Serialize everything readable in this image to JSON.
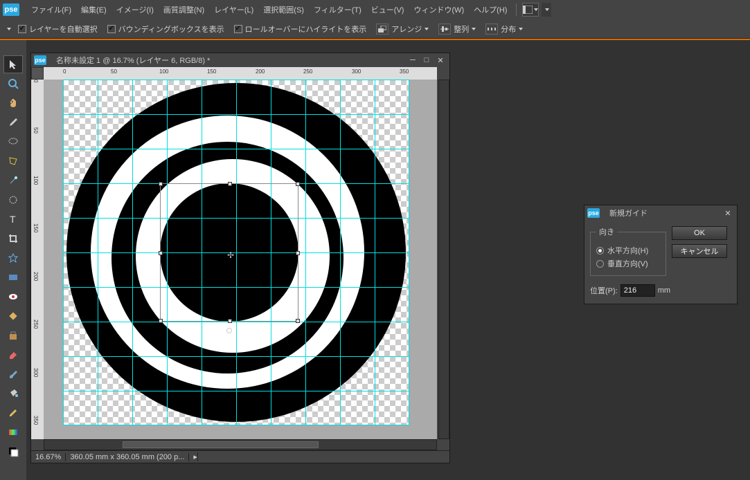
{
  "menubar": {
    "logo": "pse",
    "items": [
      "ファイル(F)",
      "編集(E)",
      "イメージ(I)",
      "画質調整(N)",
      "レイヤー(L)",
      "選択範囲(S)",
      "フィルター(T)",
      "ビュー(V)",
      "ウィンドウ(W)",
      "ヘルプ(H)"
    ]
  },
  "options": {
    "auto_select": "レイヤーを自動選択",
    "show_bbox": "バウンディングボックスを表示",
    "show_highlight": "ロールオーバーにハイライトを表示",
    "arrange": "アレンジ",
    "align": "整列",
    "distribute": "分布"
  },
  "document": {
    "title": "名称未設定 1 @ 16.7% (レイヤー 6, RGB/8) *",
    "ruler_h": [
      "0",
      "50",
      "100",
      "150",
      "200",
      "250",
      "300",
      "350"
    ],
    "ruler_v": [
      "0",
      "50",
      "100",
      "150",
      "200",
      "250",
      "300",
      "350"
    ],
    "status_zoom": "16.67%",
    "status_dims": "360.05 mm x 360.05 mm (200 p..."
  },
  "tools": [
    "move",
    "zoom",
    "hand",
    "eyedropper",
    "lasso",
    "poly-lasso",
    "magic-wand",
    "quick-select",
    "type",
    "crop",
    "shape",
    "rect",
    "red-eye",
    "heal",
    "clone",
    "eraser",
    "brush",
    "paint-bucket",
    "pencil",
    "gradient",
    "swatch",
    "more"
  ],
  "dialog": {
    "title": "新規ガイド",
    "orientation_label": "向き",
    "horizontal": "水平方向(H)",
    "vertical": "垂直方向(V)",
    "ok": "OK",
    "cancel": "キャンセル",
    "position_label": "位置(P):",
    "position_value": "216",
    "position_unit": "mm"
  }
}
